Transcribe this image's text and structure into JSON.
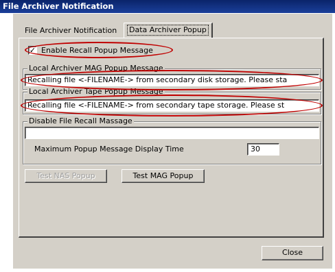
{
  "window": {
    "title": "File Archiver Notification"
  },
  "tabs": [
    {
      "label": "File Archiver Notification",
      "active": false
    },
    {
      "label": "Data Archiver Popup",
      "active": true
    }
  ],
  "enable_recall": {
    "label": "Enable Recall Popup Message",
    "checked": true,
    "mark": "✓"
  },
  "mag_group": {
    "label": "Local Archiver MAG Popup Message",
    "value": "Recalling file <-FILENAME-> from secondary disk storage.  Please sta"
  },
  "tape_group": {
    "label": "Local Archiver Tape Popup Message",
    "value": "Recalling file <-FILENAME-> from secondary tape storage.  Please st"
  },
  "disable_group": {
    "label": "Disable File Recall Massage",
    "value": "",
    "max_time_label": "Maximum Popup Message Display Time",
    "max_time_value": "30"
  },
  "buttons": {
    "test_nas": "Test NAS Popup",
    "test_mag": "Test MAG Popup",
    "close": "Close"
  },
  "colors": {
    "titlebar": "#0a246a",
    "highlight_oval": "#c00000",
    "dialog": "#d4d0c8"
  }
}
